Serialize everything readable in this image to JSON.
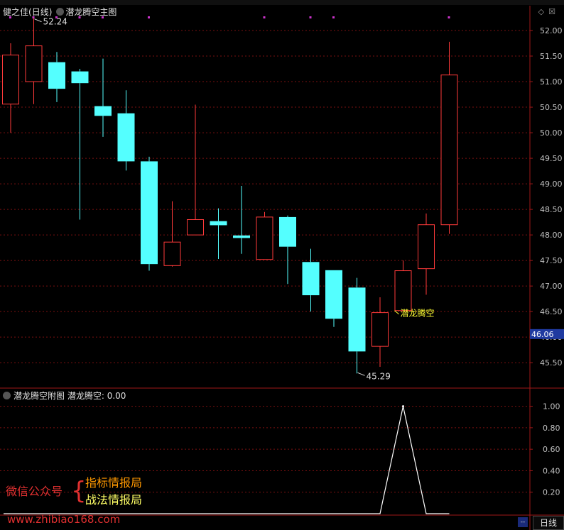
{
  "main_panel": {
    "stock_name": "健之佳",
    "period": "(日线)",
    "indicator_title": "潜龙腾空主图"
  },
  "sub_panel": {
    "title": "潜龙腾空附图",
    "series_label": "潜龙腾空:",
    "series_value": "0.00"
  },
  "watermark": {
    "account": "微信公众号",
    "line1": "指标情报局",
    "line2": "战法情报局",
    "url": "www.zhibiao168.com"
  },
  "bottom": {
    "period_tab": "日线",
    "dash": "--"
  },
  "colors": {
    "up": "#ff3a3a",
    "down": "#54ffff",
    "grid": "#7a1010",
    "axis_text": "#c0c0c0",
    "marker": "#cc33cc",
    "annotation": "#ffff33",
    "price_box": "#1f3aa0",
    "sub_line": "#ffffff"
  },
  "chart_data": [
    {
      "type": "candlestick",
      "title": "潜龙腾空主图",
      "ylim": [
        45.1,
        52.25
      ],
      "yticks": [
        45.5,
        46.0,
        46.5,
        47.0,
        47.5,
        48.0,
        48.5,
        49.0,
        49.5,
        50.0,
        50.5,
        51.0,
        51.5,
        52.0
      ],
      "current_price": "46.06",
      "high_label": "52.24",
      "low_label": "45.29",
      "signal_label": "潜龙腾空",
      "signal_bar": 17,
      "candles": [
        {
          "o": 50.56,
          "h": 51.75,
          "l": 50.0,
          "c": 51.52
        },
        {
          "o": 51.0,
          "h": 52.24,
          "l": 50.56,
          "c": 51.7
        },
        {
          "o": 51.38,
          "h": 51.58,
          "l": 50.6,
          "c": 50.86
        },
        {
          "o": 51.2,
          "h": 51.25,
          "l": 48.3,
          "c": 50.97
        },
        {
          "o": 50.52,
          "h": 51.45,
          "l": 49.92,
          "c": 50.33
        },
        {
          "o": 50.38,
          "h": 50.83,
          "l": 49.26,
          "c": 49.44
        },
        {
          "o": 49.44,
          "h": 49.53,
          "l": 47.3,
          "c": 47.43
        },
        {
          "o": 47.4,
          "h": 48.66,
          "l": 47.38,
          "c": 47.86
        },
        {
          "o": 48.0,
          "h": 50.55,
          "l": 48.0,
          "c": 48.3
        },
        {
          "o": 48.27,
          "h": 48.52,
          "l": 47.53,
          "c": 48.19
        },
        {
          "o": 47.99,
          "h": 48.96,
          "l": 47.63,
          "c": 47.94
        },
        {
          "o": 47.52,
          "h": 48.45,
          "l": 47.52,
          "c": 48.35
        },
        {
          "o": 48.35,
          "h": 48.38,
          "l": 47.04,
          "c": 47.77
        },
        {
          "o": 47.47,
          "h": 47.73,
          "l": 46.5,
          "c": 46.82
        },
        {
          "o": 47.31,
          "h": 47.31,
          "l": 46.2,
          "c": 46.36
        },
        {
          "o": 46.97,
          "h": 47.16,
          "l": 45.29,
          "c": 45.72
        },
        {
          "o": 45.82,
          "h": 46.78,
          "l": 45.42,
          "c": 46.48
        },
        {
          "o": 46.52,
          "h": 47.5,
          "l": 46.52,
          "c": 47.3
        },
        {
          "o": 47.34,
          "h": 48.42,
          "l": 46.83,
          "c": 48.2
        },
        {
          "o": 48.2,
          "h": 51.78,
          "l": 48.02,
          "c": 51.13
        }
      ],
      "markers_on_bars": [
        0,
        1,
        2,
        3,
        4,
        6,
        11,
        13,
        14,
        19
      ]
    },
    {
      "type": "line",
      "title": "潜龙腾空附图",
      "ylim": [
        0,
        1.07
      ],
      "yticks": [
        0.2,
        0.4,
        0.6,
        0.8,
        1.0
      ],
      "values": [
        0,
        0,
        0,
        0,
        0,
        0,
        0,
        0,
        0,
        0,
        0,
        0,
        0,
        0,
        0,
        0,
        0,
        1,
        0,
        0
      ]
    }
  ]
}
